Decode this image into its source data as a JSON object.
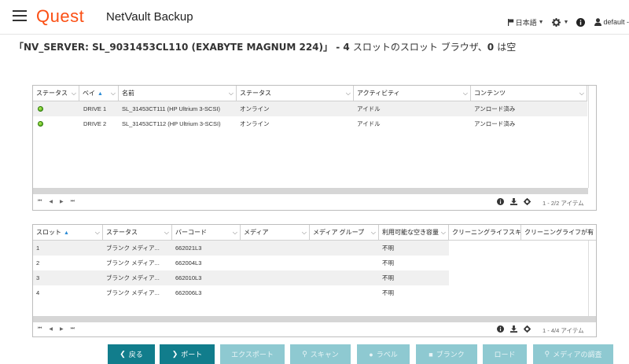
{
  "header": {
    "logo": "Quest",
    "app_name": "NetVault Backup",
    "language": "日本語",
    "user": "default -"
  },
  "title": {
    "prefix": "「NV_SERVER: SL_9031453CL110 (EXABYTE MAGNUM 224)」",
    "suffix_a": " - 4 ",
    "suffix_b": "スロットのスロット ブラウザ、",
    "suffix_c": "0 ",
    "suffix_d": "は空"
  },
  "drives_grid": {
    "columns": [
      "ステータス",
      "ベイ",
      "名前",
      "ステータス",
      "アクティビティ",
      "コンテンツ"
    ],
    "rows": [
      {
        "status": "green",
        "bay": "DRIVE 1",
        "name": "SL_31453CT111 (HP Ultrium 3-SCSI)",
        "state": "オンライン",
        "activity": "アイドル",
        "contents": "アンロード済み"
      },
      {
        "status": "green",
        "bay": "DRIVE 2",
        "name": "SL_31453CT112 (HP Ultrium 3-SCSI)",
        "state": "オンライン",
        "activity": "アイドル",
        "contents": "アンロード済み"
      }
    ],
    "count_text": "1 - 2/2 アイテム"
  },
  "slots_grid": {
    "columns": [
      "スロット",
      "ステータス",
      "バーコード",
      "メディア",
      "メディア グループ",
      "利用可能な空き容量",
      "クリーニングライフスキ",
      "クリーニングライフが有"
    ],
    "rows": [
      {
        "slot": "1",
        "status": "ブランク メディア...",
        "barcode": "662021L3",
        "media": "",
        "group": "",
        "free": "不明",
        "c1": "",
        "c2": ""
      },
      {
        "slot": "2",
        "status": "ブランク メディア...",
        "barcode": "662004L3",
        "media": "",
        "group": "",
        "free": "不明",
        "c1": "",
        "c2": ""
      },
      {
        "slot": "3",
        "status": "ブランク メディア...",
        "barcode": "662010L3",
        "media": "",
        "group": "",
        "free": "不明",
        "c1": "",
        "c2": ""
      },
      {
        "slot": "4",
        "status": "ブランク メディア...",
        "barcode": "662006L3",
        "media": "",
        "group": "",
        "free": "不明",
        "c1": "",
        "c2": ""
      }
    ],
    "count_text": "1 - 4/4 アイテム"
  },
  "buttons": {
    "back": "戻る",
    "port": "ポート",
    "export": "エクスポート",
    "scan": "スキャン",
    "label": "ラベル",
    "blank": "ブランク",
    "load": "ロード",
    "media_lookup": "メディアの調査"
  },
  "colors": {
    "brand": "#fb4f14",
    "button_primary": "#117d8c",
    "button_disabled": "#8ec9d1",
    "sort_arrow": "#2b8bd6"
  }
}
